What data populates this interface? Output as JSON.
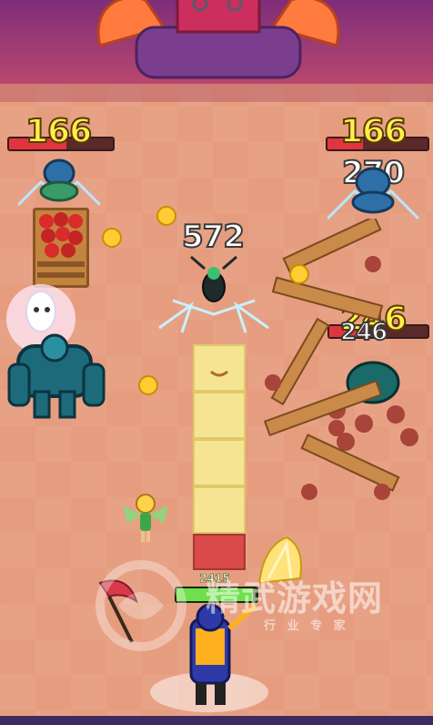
{
  "enemies": [
    {
      "name": "spider-top-left",
      "damage": "166",
      "hp_fraction": 0.55
    },
    {
      "name": "spider-top-right",
      "damage": "166",
      "damage2": "270",
      "hp_fraction": 0.35
    },
    {
      "name": "fly-center",
      "damage": "572"
    },
    {
      "name": "beetle-right",
      "damage": "246",
      "damage2": "246",
      "hp_fraction": 0.4
    }
  ],
  "player": {
    "hp_label": "2415",
    "hp_fraction": 0.95
  },
  "watermark": {
    "title": "精武游戏网",
    "subtitle": "行 业 专 家"
  },
  "colors": {
    "damage": "#fff04c",
    "hp_enemy": "#e0353f",
    "hp_player": "#6fe04b",
    "floor": "#e69d7f"
  }
}
